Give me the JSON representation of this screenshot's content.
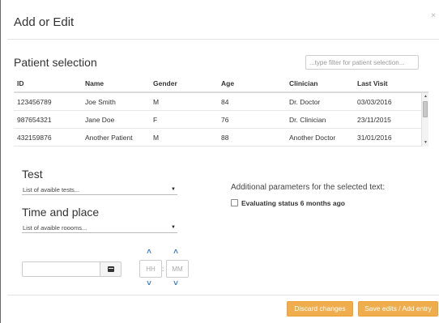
{
  "dialog": {
    "title": "Add or Edit",
    "close_glyph": "×"
  },
  "patient_selection": {
    "title": "Patient selection",
    "filter_placeholder": "...type filter for patient selection...",
    "columns": [
      "ID",
      "Name",
      "Gender",
      "Age",
      "Clinician",
      "Last Visit"
    ],
    "rows": [
      [
        "123456789",
        "Joe Smith",
        "M",
        "84",
        "Dr. Doctor",
        "03/03/2016"
      ],
      [
        "987654321",
        "Jane Doe",
        "F",
        "76",
        "Dr. Clinician",
        "23/11/2015"
      ],
      [
        "432159876",
        "Another Patient",
        "M",
        "88",
        "Another Doctor",
        "31/01/2016"
      ]
    ]
  },
  "test": {
    "title": "Test",
    "select_value": "List of avaible tests..."
  },
  "time_place": {
    "title": "Time and place",
    "select_value": "List of avaible roooms...",
    "date_value": "",
    "hour_placeholder": "HH",
    "minute_placeholder": "MM",
    "separator": ":"
  },
  "additional": {
    "text": "Additional parameters for the selected text:",
    "checkbox_label": "Evaluating status 6 months ago",
    "checkbox_checked": false
  },
  "footer": {
    "discard_label": "Discard changes",
    "save_label": "Save edits / Add entry"
  },
  "colors": {
    "accent_orange": "#f0ad4e",
    "time_arrow_blue": "#3a7cc4"
  },
  "icons": {
    "close": "close-icon",
    "calendar": "calendar-icon",
    "caret": "chevron-down-icon",
    "arrow_up": "chevron-up-icon",
    "arrow_down": "chevron-down-icon"
  }
}
